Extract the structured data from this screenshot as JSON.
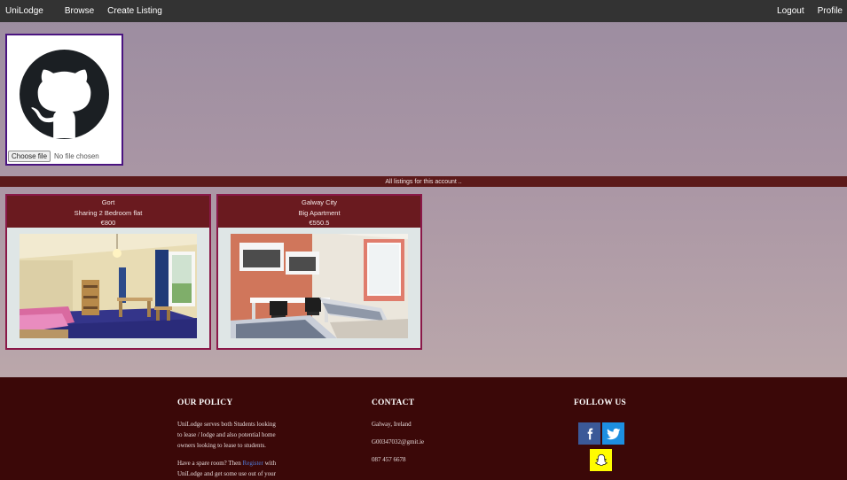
{
  "nav": {
    "brand": "UniLodge",
    "browse": "Browse",
    "create": "Create Listing",
    "logout": "Logout",
    "profile": "Profile"
  },
  "upload": {
    "button": "Choose file",
    "status": "No file chosen"
  },
  "listings_header": "All listings for this account ..",
  "listings": [
    {
      "location": "Gort",
      "title": "Sharing 2 Bedroom flat",
      "price": "€800"
    },
    {
      "location": "Galway City",
      "title": "Big Apartment",
      "price": "€550.5"
    }
  ],
  "footer": {
    "policy": {
      "title": "OUR POLICY",
      "para1_lines": [
        "UniLodge serves both Students looking",
        "to lease / lodge and also potential home",
        "owners looking to lease to students."
      ],
      "para2_start": "Have a spare room? Then ",
      "para2_link": "Register",
      "para2_end": " with",
      "para2_line2": "UniLodge and get some use out of your"
    },
    "contact": {
      "title": "CONTACT",
      "address": "Galway, Ireland",
      "email": "G00347032@gmit.ie",
      "phone": "087 457 6678"
    },
    "follow": {
      "title": "FOLLOW US",
      "facebook_color": "#3b5998",
      "twitter_color": "#1d8fe0",
      "snapchat_color": "#fffc00"
    }
  },
  "colors": {
    "navbar": "#333333",
    "listings_bar": "#5c1a1a",
    "card_header": "#6a1a1f",
    "footer": "#3b0808"
  }
}
